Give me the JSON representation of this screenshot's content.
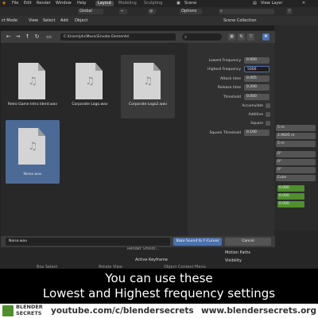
{
  "topbar": {
    "menus": [
      "File",
      "Edit",
      "Render",
      "Window",
      "Help"
    ],
    "workspace_tabs": [
      "Layout",
      "Modeling",
      "Sculpting"
    ],
    "active_tab": "Layout",
    "scene_label": "Scene",
    "view_layer_label": "View Layer"
  },
  "header2": {
    "global_label": "Global",
    "options_label": "Options"
  },
  "header3": {
    "mode_label": "ct Mode",
    "menu_items": [
      "View",
      "Select",
      "Add",
      "Object"
    ],
    "scene_collection_label": "Scene Collection"
  },
  "dialog": {
    "path": "C:\\Users\\jdv\\Music\\Envato Elements\\",
    "files": [
      {
        "name": "Retro Game Intro Ident.wav",
        "state": "normal"
      },
      {
        "name": "Corporate Logo.wav",
        "state": "normal"
      },
      {
        "name": "Corporate Logo2.wav",
        "state": "hover"
      },
      {
        "name": "Noise.wav",
        "state": "selected"
      }
    ],
    "settings": [
      {
        "label": "Lowest Frequency",
        "value": "0.000",
        "type": "number"
      },
      {
        "label": "Highest Frequency",
        "value": "5000",
        "type": "editing"
      },
      {
        "label": "Attack time",
        "value": "0.005",
        "type": "number"
      },
      {
        "label": "Release time",
        "value": "0.200",
        "type": "number"
      },
      {
        "label": "Threshold",
        "value": "0.000",
        "type": "number"
      },
      {
        "label": "Accumulate",
        "value": "",
        "type": "checkbox"
      },
      {
        "label": "Additive",
        "value": "",
        "type": "checkbox"
      },
      {
        "label": "Square",
        "value": "",
        "type": "checkbox"
      },
      {
        "label": "Square Threshold",
        "value": "0.100",
        "type": "number"
      }
    ],
    "filename": "Noise.wav",
    "confirm_label": "Bake Sound to F-Curves",
    "cancel_label": "Cancel"
  },
  "right_panel": {
    "rows": [
      "5 m",
      "2.9605 m",
      "5 m",
      "0°",
      "0°",
      "0°",
      "Euler"
    ],
    "green_values": [
      "0.000",
      "0.000",
      "0.000"
    ]
  },
  "lower_area": {
    "left_items": [
      "Box Select",
      "Rotate View",
      "Object Context Menu"
    ],
    "row_items": [
      "Active Keyframe",
      "Motion Paths",
      "Visibility"
    ],
    "render_label": "Render Smoot..."
  },
  "caption": {
    "line1": "You can use these",
    "line2": "Lowest and Highest frequency settings"
  },
  "footer": {
    "brand_line1": "BLENDER",
    "brand_line2": "SECRETS",
    "youtube": "youtube.com/c/blendersecrets",
    "website": "www.blendersecrets.org"
  },
  "colors": {
    "accent_blue": "#4a72b0",
    "selection_blue": "#4c6a96",
    "green": "#4f8f2e"
  }
}
